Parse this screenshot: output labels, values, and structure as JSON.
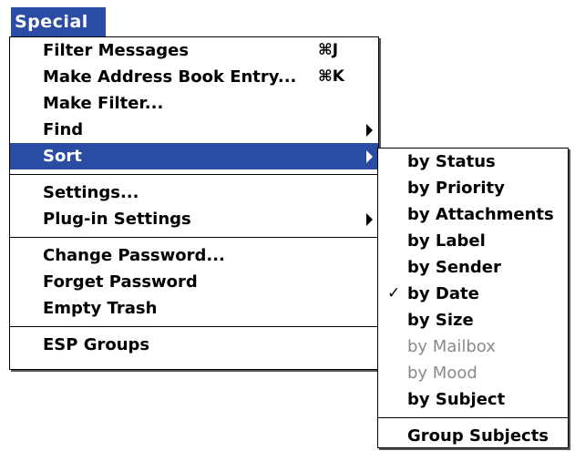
{
  "menubar": {
    "title": "Special"
  },
  "main_menu": {
    "group1": [
      {
        "label": "Filter Messages",
        "shortcut": "⌘J"
      },
      {
        "label": "Make Address Book Entry...",
        "shortcut": "⌘K"
      },
      {
        "label": "Make Filter..."
      },
      {
        "label": "Find"
      },
      {
        "label": "Sort"
      }
    ],
    "group2": [
      {
        "label": "Settings..."
      },
      {
        "label": "Plug-in Settings"
      }
    ],
    "group3": [
      {
        "label": "Change Password..."
      },
      {
        "label": "Forget Password"
      },
      {
        "label": "Empty Trash"
      }
    ],
    "group4": [
      {
        "label": "ESP Groups"
      }
    ]
  },
  "sort_submenu": {
    "items": [
      {
        "label": "by Status"
      },
      {
        "label": "by Priority"
      },
      {
        "label": "by Attachments"
      },
      {
        "label": "by Label"
      },
      {
        "label": "by Sender"
      },
      {
        "label": "by Date",
        "check": "✓"
      },
      {
        "label": "by Size"
      },
      {
        "label": "by Mailbox"
      },
      {
        "label": "by Mood"
      },
      {
        "label": "by Subject"
      }
    ],
    "footer": [
      {
        "label": "Group Subjects"
      }
    ]
  },
  "colors": {
    "highlight": "#2a4da3",
    "disabled_text": "#8a8a8a"
  }
}
